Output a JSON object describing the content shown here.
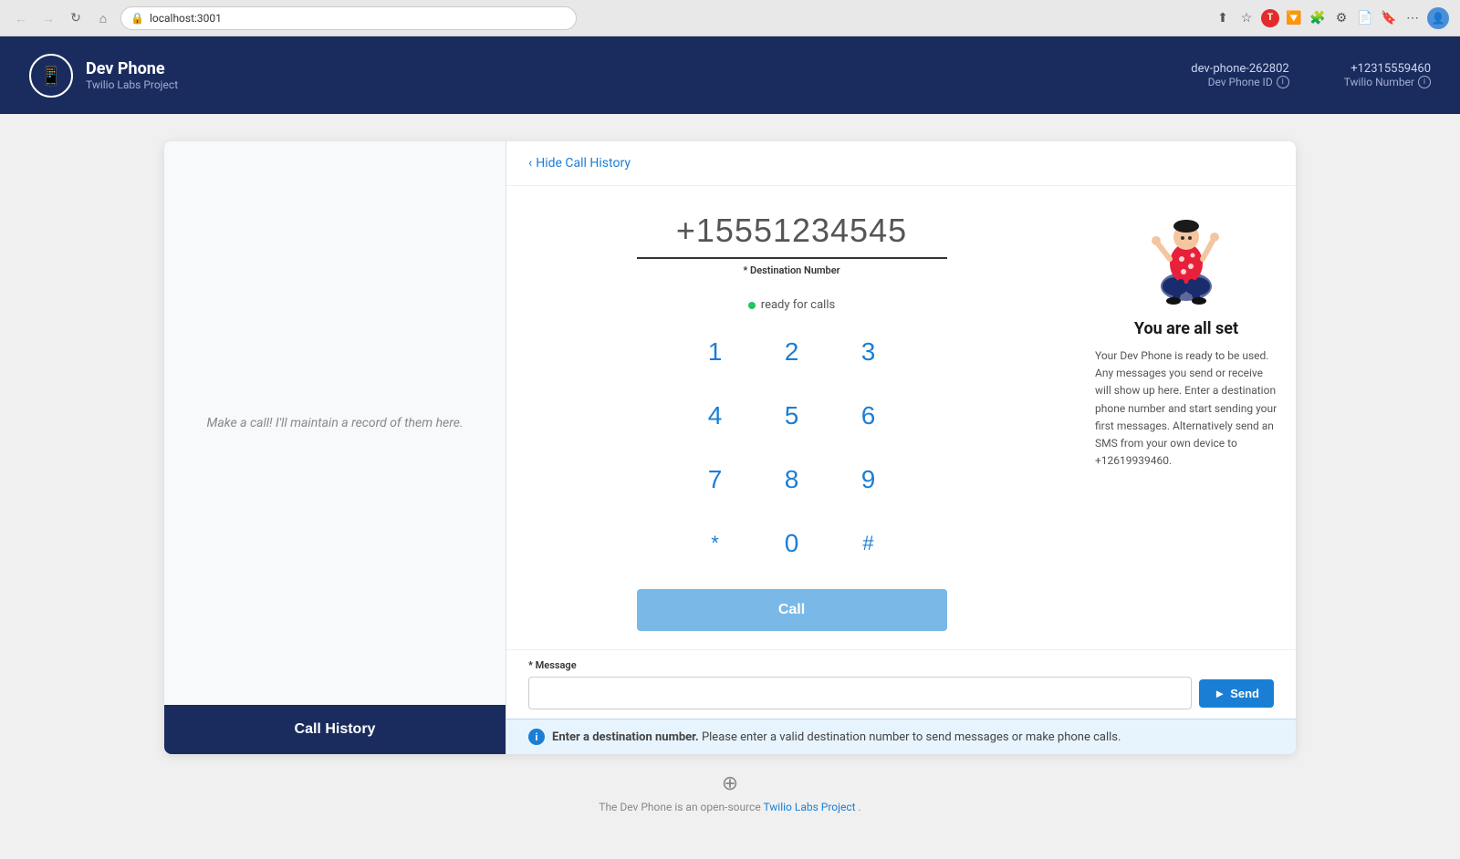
{
  "browser": {
    "url": "localhost:3001",
    "back_disabled": true,
    "forward_disabled": true
  },
  "header": {
    "logo_text": "📞",
    "app_name": "Dev Phone",
    "app_subtitle": "Twilio Labs Project",
    "dev_phone_id": "dev-phone-262802",
    "dev_phone_id_label": "Dev Phone ID",
    "twilio_number": "+12315559460",
    "twilio_number_label": "Twilio Number"
  },
  "left_panel": {
    "empty_message": "Make a call! I'll maintain a record of them here.",
    "call_history_button": "Call History"
  },
  "top_bar": {
    "hide_label": "Hide Call History"
  },
  "dialer": {
    "phone_number": "+15551234545",
    "destination_label": "* Destination Number",
    "status": "ready for calls",
    "keys": [
      {
        "label": "1",
        "key": "1"
      },
      {
        "label": "2",
        "key": "2"
      },
      {
        "label": "3",
        "key": "3"
      },
      {
        "label": "4",
        "key": "4"
      },
      {
        "label": "5",
        "key": "5"
      },
      {
        "label": "6",
        "key": "6"
      },
      {
        "label": "7",
        "key": "7"
      },
      {
        "label": "8",
        "key": "8"
      },
      {
        "label": "9",
        "key": "9"
      },
      {
        "label": "*",
        "key": "*"
      },
      {
        "label": "0",
        "key": "0"
      },
      {
        "label": "#",
        "key": "#"
      }
    ],
    "call_button": "Call"
  },
  "info_panel": {
    "title": "You are all set",
    "description": "Your Dev Phone is ready to be used. Any messages you send or receive will show up here. Enter a destination phone number and start sending your first messages. Alternatively send an SMS from your own device to +12619939460."
  },
  "message": {
    "label": "* Message",
    "placeholder": "",
    "send_button": "Send"
  },
  "warning": {
    "bold_text": "Enter a destination number.",
    "text": " Please enter a valid destination number to send messages or make phone calls."
  },
  "footer": {
    "icon": "⊕",
    "text": "The Dev Phone is an open-source ",
    "link_text": "Twilio Labs Project",
    "link_suffix": "."
  }
}
